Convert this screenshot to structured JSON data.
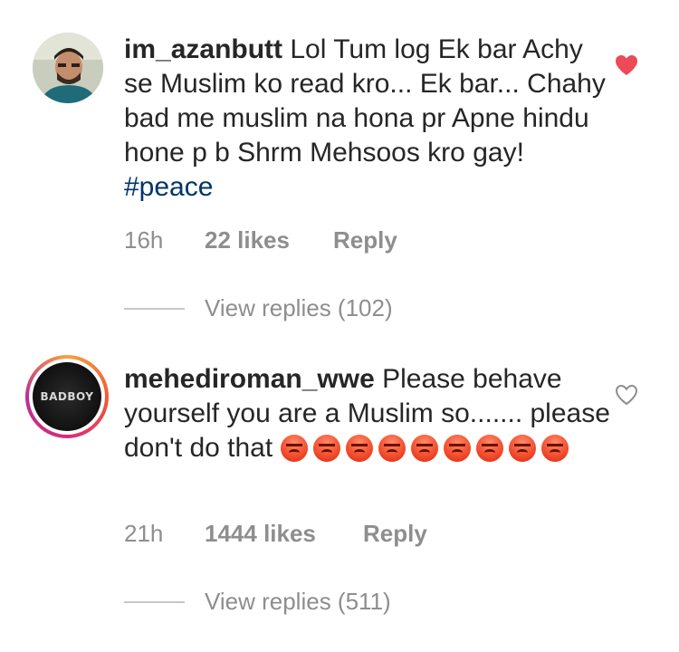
{
  "comments": [
    {
      "username": "im_azanbutt",
      "text": "Lol Tum log Ek bar Achy se Muslim ko read kro... Ek bar... Chahy bad me muslim na hona pr Apne hindu hone p b Shrm Mehsoos kro gay!",
      "hashtag": "#peace",
      "time": "16h",
      "likes": "22 likes",
      "reply_label": "Reply",
      "view_replies": "View replies (102)",
      "liked": true,
      "heart_color": "#ed4956"
    },
    {
      "username": "mehediroman_wwe",
      "text": "Please behave yourself you are a Muslim so....... please don't do that",
      "avatar_text": "BADBOY",
      "emoji_icon": "angry-face-emoji",
      "emoji_count": 9,
      "time": "21h",
      "likes": "1444 likes",
      "reply_label": "Reply",
      "view_replies": "View replies (511)",
      "liked": false
    }
  ],
  "colors": {
    "text": "#262626",
    "muted": "#8e8e8e",
    "hashtag": "#003569",
    "heart": "#ed4956"
  }
}
